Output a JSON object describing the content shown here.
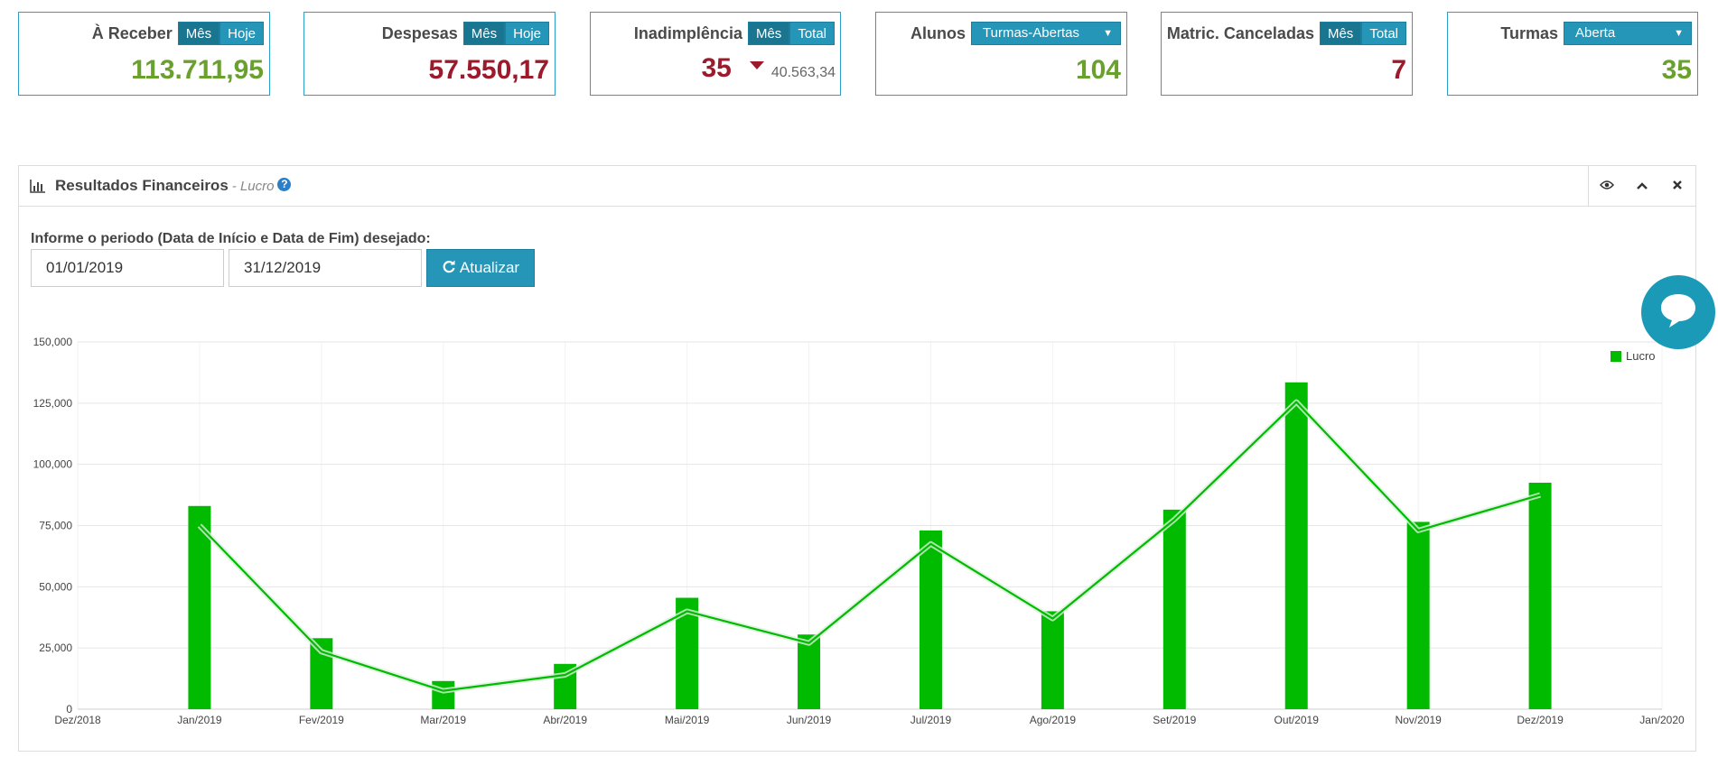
{
  "cards": {
    "receber": {
      "label": "À Receber",
      "seg": [
        "Mês",
        "Hoje"
      ],
      "value": "113.711,95"
    },
    "despesas": {
      "label": "Despesas",
      "seg": [
        "Mês",
        "Hoje"
      ],
      "value": "57.550,17"
    },
    "inadimplencia": {
      "label": "Inadimplência",
      "seg": [
        "Mês",
        "Total"
      ],
      "value": "35",
      "sub": "40.563,34"
    },
    "alunos": {
      "label": "Alunos",
      "dropdown": "Turmas-Abertas",
      "value": "104"
    },
    "canceladas": {
      "label": "Matric. Canceladas",
      "seg": [
        "Mês",
        "Total"
      ],
      "value": "7"
    },
    "turmas": {
      "label": "Turmas",
      "dropdown": "Aberta",
      "value": "35"
    }
  },
  "panel": {
    "title": "Resultados Financeiros",
    "subtitle": "- Lucro",
    "period_label": "Informe o periodo (Data de Início e Data de Fim) desejado:",
    "start_date": "01/01/2019",
    "end_date": "31/12/2019",
    "update_label": "Atualizar"
  },
  "colors": {
    "accent": "#2596b8",
    "positive": "#6aa12e",
    "negative": "#9c1a2b",
    "series": "#00bb00"
  },
  "icons": [
    "bar-chart-icon",
    "question-icon",
    "eye-icon",
    "chevron-up-icon",
    "close-icon",
    "refresh-icon",
    "chat-icon",
    "caret-down-icon"
  ],
  "chart_data": {
    "type": "bar",
    "categories": [
      "Jan/2019",
      "Fev/2019",
      "Mar/2019",
      "Abr/2019",
      "Mai/2019",
      "Jun/2019",
      "Jul/2019",
      "Ago/2019",
      "Set/2019",
      "Out/2019",
      "Nov/2019",
      "Dez/2019"
    ],
    "x_ticks": [
      "Dez/2018",
      "Jan/2019",
      "Fev/2019",
      "Mar/2019",
      "Abr/2019",
      "Mai/2019",
      "Jun/2019",
      "Jul/2019",
      "Ago/2019",
      "Set/2019",
      "Out/2019",
      "Nov/2019",
      "Dez/2019",
      "Jan/2020"
    ],
    "y_ticks": [
      "0",
      "25,000",
      "50,000",
      "75,000",
      "100,000",
      "125,000",
      "150,000"
    ],
    "ylim": [
      0,
      150000
    ],
    "series": [
      {
        "name": "Lucro",
        "values": [
          83000,
          29000,
          11500,
          18500,
          45500,
          30500,
          73000,
          40000,
          81500,
          133500,
          76500,
          92500
        ]
      }
    ],
    "line_values": [
      75000,
      23500,
      7500,
      14000,
      40000,
      27000,
      67500,
      37000,
      77500,
      125500,
      73000,
      87500
    ],
    "legend": {
      "label": "Lucro",
      "position": "top-right"
    },
    "grid": true
  }
}
